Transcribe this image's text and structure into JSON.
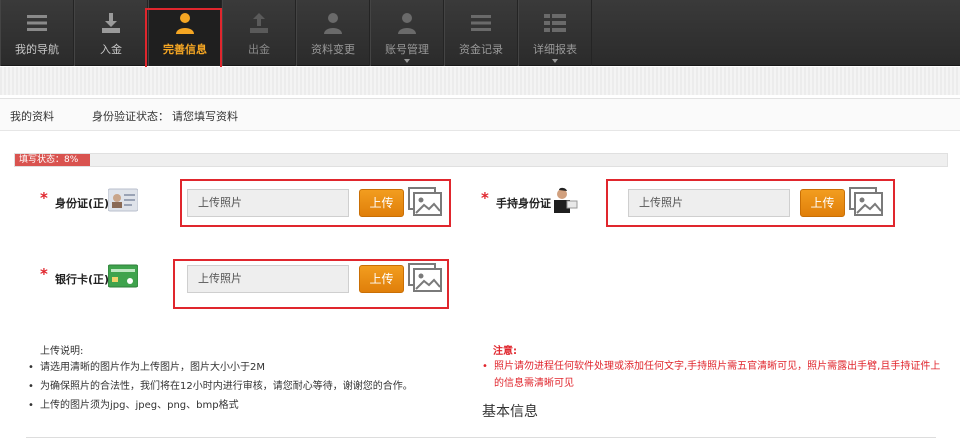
{
  "nav": {
    "items": [
      {
        "label": "我的导航",
        "icon": "dashboard-icon"
      },
      {
        "label": "入金",
        "icon": "download-icon"
      },
      {
        "label": "完善信息",
        "icon": "user-icon"
      },
      {
        "label": "出金",
        "icon": "upload-icon"
      },
      {
        "label": "资料变更",
        "icon": "user-icon"
      },
      {
        "label": "账号管理",
        "icon": "user-icon"
      },
      {
        "label": "资金记录",
        "icon": "list-icon"
      },
      {
        "label": "详细报表",
        "icon": "table-icon"
      }
    ],
    "active_index": 2,
    "active_color": "#f5a623"
  },
  "panel": {
    "title": "我的资料",
    "status_label": "身份验证状态：",
    "status_value": "请您填写资料"
  },
  "progress": {
    "label": "填写状态：8%",
    "percent": 8,
    "color": "#d9534f"
  },
  "uploads": {
    "id_front": {
      "label": "身份证(正)",
      "placeholder": "上传照片",
      "button": "上传"
    },
    "hand_held": {
      "label": "手持身份证",
      "placeholder": "上传照片",
      "button": "上传"
    },
    "bank_card": {
      "label": "银行卡(正)",
      "placeholder": "上传照片",
      "button": "上传"
    }
  },
  "notes": {
    "title": "上传说明:",
    "items": [
      "请选用清晰的图片作为上传图片，图片大小小于2M",
      "为确保照片的合法性，我们将在12小时内进行审核，请您耐心等待，谢谢您的合作。",
      "上传的图片须为jpg、jpeg、png、bmp格式"
    ]
  },
  "warning": {
    "title": "注意:",
    "items": [
      "照片请勿进程任何软件处理或添加任何文字,手持照片需五官清晰可见，照片需露出手臂,且手持证件上的信息需清晰可见"
    ]
  },
  "section": {
    "basic_info": "基本信息"
  },
  "colors": {
    "accent": "#e8890f",
    "highlight_border": "#e0262d"
  }
}
